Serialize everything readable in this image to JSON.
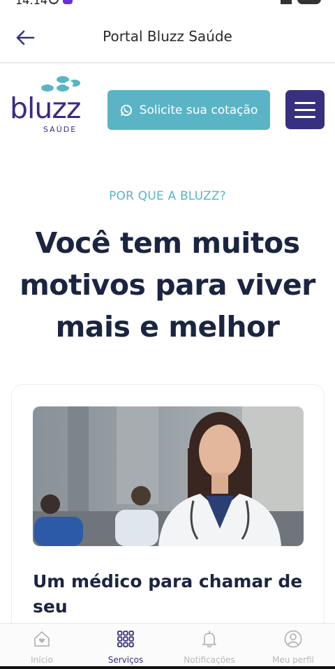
{
  "status_bar": {
    "time": "14:14"
  },
  "app_bar": {
    "title": "Portal Bluzz Saúde"
  },
  "header": {
    "logo_word": "bluzz",
    "logo_sub": "SAÚDE",
    "cta_label": "Solicite sua cotação"
  },
  "hero": {
    "eyebrow": "POR QUE A BLUZZ?",
    "headline": "Você tem muitos motivos para viver mais e melhor"
  },
  "card": {
    "title": "Um médico para chamar de seu"
  },
  "bottom_nav": {
    "items": [
      {
        "label": "Início",
        "icon": "home-heart-icon"
      },
      {
        "label": "Serviços",
        "icon": "grid-icon"
      },
      {
        "label": "Notificações",
        "icon": "bell-icon"
      },
      {
        "label": "Meu perfil",
        "icon": "user-circle-icon"
      }
    ],
    "active": "Serviços"
  },
  "colors": {
    "brand_purple": "#36307f",
    "accent_teal": "#5ab4c6",
    "headline_navy": "#1b2541"
  }
}
